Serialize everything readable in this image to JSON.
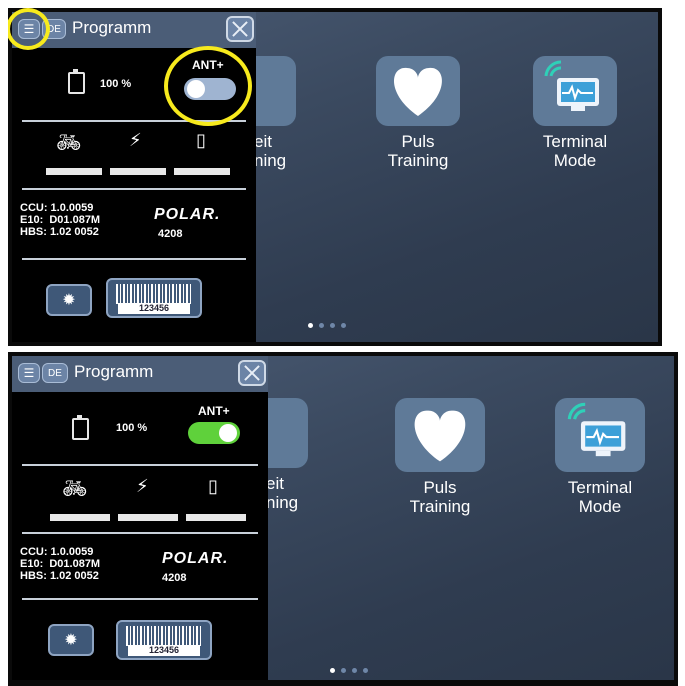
{
  "panel": {
    "title": "Programm",
    "lang_button": "DE",
    "battery_percent": "100 %",
    "ant_label": "ANT+",
    "versions": "CCU: 1.0.0059\nE10:  D01.087M\nHBS: 1.02 0052",
    "brand": "POLAR.",
    "polar_code": "4208",
    "barcode_number": "123456"
  },
  "tiles": {
    "partial_line1": "eit",
    "partial_line2": "ning",
    "puls_line1": "Puls",
    "puls_line2": "Training",
    "terminal_line1": "Terminal",
    "terminal_line2": "Mode"
  },
  "states": {
    "top_ant_enabled": false,
    "bottom_ant_enabled": true
  },
  "colors": {
    "toggle_off": "#9fb4d1",
    "toggle_on": "#5fd13b",
    "highlight": "#f7ea1d"
  },
  "icons": {
    "menu": "menu-icon",
    "close": "close-icon",
    "battery": "battery-icon",
    "bike": "bike-icon",
    "charging": "charging-icon",
    "phone": "phone-icon",
    "settings": "gear-icon",
    "heart": "heart-icon",
    "terminal": "monitor-icon",
    "bulb": "bulb-icon"
  }
}
